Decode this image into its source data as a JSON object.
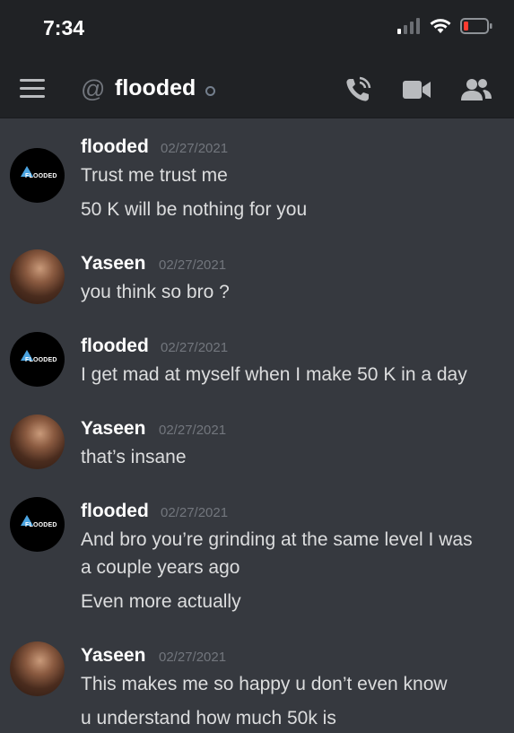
{
  "status_bar": {
    "time": "7:34"
  },
  "header": {
    "at_symbol": "@",
    "channel": "flooded"
  },
  "avatar_logo_text": "FLOODED",
  "messages": [
    {
      "author": "flooded",
      "timestamp": "02/27/2021",
      "lines": [
        "Trust me trust me",
        "50 K will be nothing for you"
      ]
    },
    {
      "author": "Yaseen",
      "timestamp": "02/27/2021",
      "lines": [
        "you think so bro ?"
      ]
    },
    {
      "author": "flooded",
      "timestamp": "02/27/2021",
      "lines": [
        "I get mad at myself when I make 50 K in a day"
      ]
    },
    {
      "author": "Yaseen",
      "timestamp": "02/27/2021",
      "lines": [
        "that’s insane"
      ]
    },
    {
      "author": "flooded",
      "timestamp": "02/27/2021",
      "lines": [
        "And bro you’re grinding at the same level I was",
        "a couple years ago",
        "Even more actually"
      ]
    },
    {
      "author": "Yaseen",
      "timestamp": "02/27/2021",
      "lines": [
        "This makes me so happy u don’t even know",
        "u understand how much 50k is"
      ]
    }
  ]
}
